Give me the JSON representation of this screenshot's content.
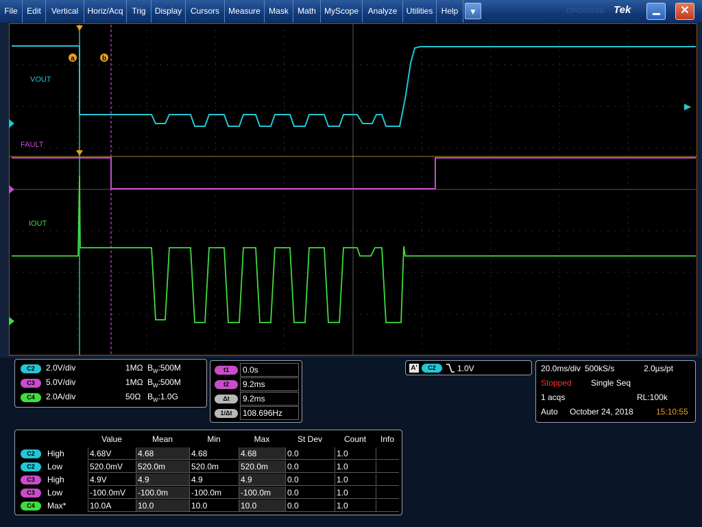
{
  "menu": [
    "File",
    "Edit",
    "Vertical",
    "Horiz/Acq",
    "Trig",
    "Display",
    "Cursors",
    "Measure",
    "Mask",
    "Math",
    "MyScope",
    "Analyze",
    "Utilities",
    "Help"
  ],
  "window": {
    "dropdown_icon": "chevron-down-icon",
    "brand_ghost": "DPO5054B",
    "brand": "Tek",
    "minimize_icon": "minimize-icon",
    "close_icon": "close-icon",
    "close_glyph": "✕"
  },
  "waveform_labels": {
    "vout": "VOUT",
    "fault": "FAULT",
    "iout": "IOUT"
  },
  "channel_markers": {
    "c2": "2",
    "c3": "3",
    "c4": "4"
  },
  "cursor_markers": {
    "a": "a",
    "b": "b"
  },
  "colors": {
    "ch2": "#22c6d6",
    "ch3": "#c94cc9",
    "ch4": "#3fdc3f",
    "cursor": "#e8a020",
    "graticule": "#6a6a6a",
    "stopped": "#ff3030",
    "time": "#e8a020"
  },
  "channels": [
    {
      "badge": "C2",
      "scale": "2.0V/div",
      "impedance": "1MΩ",
      "bw_prefix": "B",
      "bw_sub": "W",
      "bw": ":500M"
    },
    {
      "badge": "C3",
      "scale": "5.0V/div",
      "impedance": "1MΩ",
      "bw_prefix": "B",
      "bw_sub": "W",
      "bw": ":500M"
    },
    {
      "badge": "C4",
      "scale": "2.0A/div",
      "impedance": "50Ω",
      "bw_prefix": "B",
      "bw_sub": "W",
      "bw": ":1.0G"
    }
  ],
  "cursors": [
    {
      "badge": "t1",
      "value": "0.0s"
    },
    {
      "badge": "t2",
      "value": "9.2ms"
    },
    {
      "badge": "Δt",
      "value": "9.2ms"
    },
    {
      "badge": "1/Δt",
      "value": "108.696Hz"
    }
  ],
  "trigger": {
    "mode_badge": "A'",
    "source": "C2",
    "slope_icon": "falling-edge-icon",
    "level": "1.0V"
  },
  "acquisition": {
    "timebase": "20.0ms/div",
    "sample_rate": "500kS/s",
    "resolution": "2.0µs/pt",
    "status": "Stopped",
    "seq_mode": "Single Seq",
    "acqs": "1 acqs",
    "record_length": "RL:100k",
    "trigger_mode": "Auto",
    "date": "October 24, 2018",
    "time": "15:10:55"
  },
  "measurements": {
    "headers": [
      "Value",
      "Mean",
      "Min",
      "Max",
      "St Dev",
      "Count",
      "Info"
    ],
    "rows": [
      {
        "badge": "C2",
        "name": "High",
        "value": "4.68V",
        "mean": "4.68",
        "min": "4.68",
        "max": "4.68",
        "stdev": "0.0",
        "count": "1.0",
        "info": ""
      },
      {
        "badge": "C2",
        "name": "Low",
        "value": "520.0mV",
        "mean": "520.0m",
        "min": "520.0m",
        "max": "520.0m",
        "stdev": "0.0",
        "count": "1.0",
        "info": ""
      },
      {
        "badge": "C3",
        "name": "High",
        "value": "4.9V",
        "mean": "4.9",
        "min": "4.9",
        "max": "4.9",
        "stdev": "0.0",
        "count": "1.0",
        "info": ""
      },
      {
        "badge": "C3",
        "name": "Low",
        "value": "-100.0mV",
        "mean": "-100.0m",
        "min": "-100.0m",
        "max": "-100.0m",
        "stdev": "0.0",
        "count": "1.0",
        "info": ""
      },
      {
        "badge": "C4",
        "name": "Max*",
        "value": "10.0A",
        "mean": "10.0",
        "min": "10.0",
        "max": "10.0",
        "stdev": "0.0",
        "count": "1.0",
        "info": ""
      }
    ]
  }
}
